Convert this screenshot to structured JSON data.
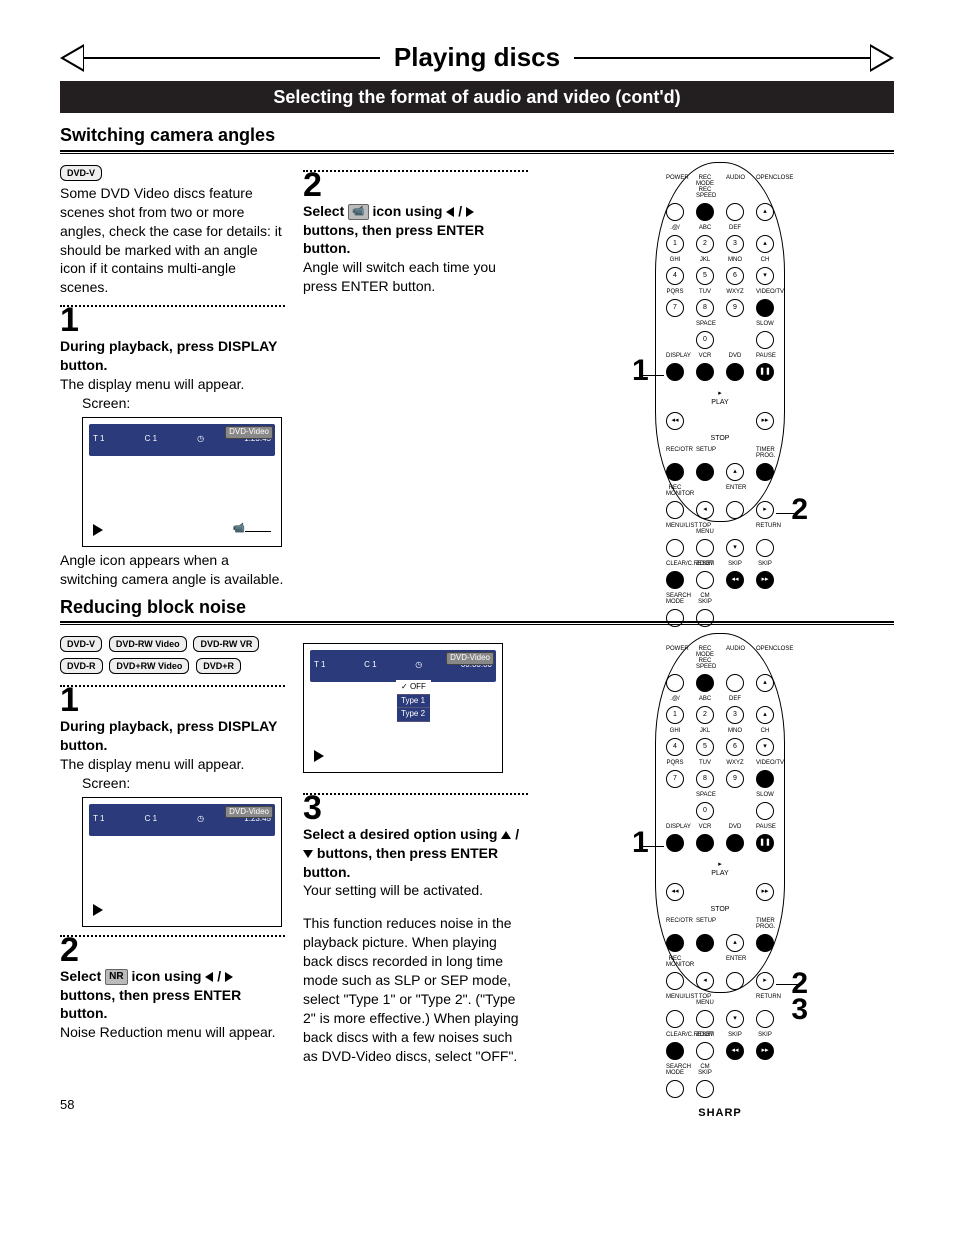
{
  "chapter_title": "Playing discs",
  "section_title": "Selecting the format of audio and video (cont'd)",
  "sections": {
    "angles": {
      "title": "Switching camera angles",
      "badge": "DVD-V",
      "intro": "Some DVD Video discs feature scenes shot from two or more angles, check the case for details: it should be marked with an angle icon if it contains multi-angle scenes.",
      "step1_title": "During playback, press DISPLAY button.",
      "step1_body": "The display menu will appear.",
      "screen_label": "Screen:",
      "osd_time": "1:23:45",
      "osd_title_a": "T   1",
      "osd_title_b": "C   1",
      "osd_tag": "DVD-Video",
      "angle_appears": "Angle icon appears when a switching camera angle is available.",
      "step2_pre": "Select",
      "step2_mid": "icon using",
      "step2_post": "buttons, then press ENTER button.",
      "step2_body": "Angle will switch each time you press ENTER button.",
      "num1": "1",
      "num2": "2"
    },
    "noise": {
      "title": "Reducing block noise",
      "badges": [
        "DVD-V",
        "DVD-RW Video",
        "DVD-RW VR",
        "DVD-R",
        "DVD+RW Video",
        "DVD+R"
      ],
      "step1_title": "During playback, press DISPLAY button.",
      "step1_body": "The display menu will appear.",
      "screen_label": "Screen:",
      "osd_time": "1:23:45",
      "osd_title_a": "T   1",
      "osd_title_b": "C   1",
      "osd_tag": "DVD-Video",
      "step2_pre": "Select",
      "step2_mid": "icon using",
      "step2_post": "buttons, then press ENTER button.",
      "step2_body": "Noise Reduction menu will appear.",
      "osd2_time": "00:00:00",
      "osd2_tag": "DVD-Video",
      "nr_opts": {
        "opt0": "OFF",
        "opt1": "Type 1",
        "opt2": "Type 2"
      },
      "step3_title_a": "Select a desired option using",
      "step3_title_b": "buttons, then press ENTER button.",
      "step3_body": "Your setting will be activated.",
      "explain": "This function reduces noise in the playback picture. When playing back discs recorded in long time mode such as SLP or SEP mode, select \"Type 1\" or \"Type 2\". (\"Type 2\" is more effective.) When playing back discs with a few noises such as DVD-Video discs, select \"OFF\".",
      "num1": "1",
      "num2": "2",
      "num3": "3"
    }
  },
  "remote": {
    "labels": {
      "r0": [
        "POWER",
        "REC MODE REC SPEED",
        "AUDIO",
        "OPENCLOSE"
      ],
      "r1": [
        ".@/",
        "ABC",
        "DEF",
        ""
      ],
      "r1n": [
        "1",
        "2",
        "3",
        ""
      ],
      "r2": [
        "GHI",
        "JKL",
        "MNO",
        "CH"
      ],
      "r2n": [
        "4",
        "5",
        "6",
        ""
      ],
      "r3": [
        "PQRS",
        "TUV",
        "WXYZ",
        "VIDEO/TV"
      ],
      "r3n": [
        "7",
        "8",
        "9",
        ""
      ],
      "r4": [
        "",
        "SPACE",
        "",
        "SLOW"
      ],
      "r4n": [
        "",
        "0",
        "",
        ""
      ],
      "r5": [
        "DISPLAY",
        "VCR",
        "DVD",
        "PAUSE"
      ],
      "play": "PLAY",
      "stop": "STOP",
      "r6": [
        "REC/OTR",
        "SETUP",
        "",
        "TIMER PROG."
      ],
      "r7": [
        "REC MONITOR",
        "",
        "ENTER",
        ""
      ],
      "r8": [
        "MENU/LIST",
        "TOP MENU",
        "",
        "RETURN"
      ],
      "r9": [
        "CLEAR/C.RESET",
        "ZOOM",
        "SKIP",
        "SKIP"
      ],
      "r10": [
        "SEARCH MODE",
        "CM SKIP",
        "",
        ""
      ],
      "logo": "SHARP"
    }
  },
  "page_number": "58",
  "icons": {
    "angle": "📹",
    "nr": "NR",
    "check": "✓"
  }
}
